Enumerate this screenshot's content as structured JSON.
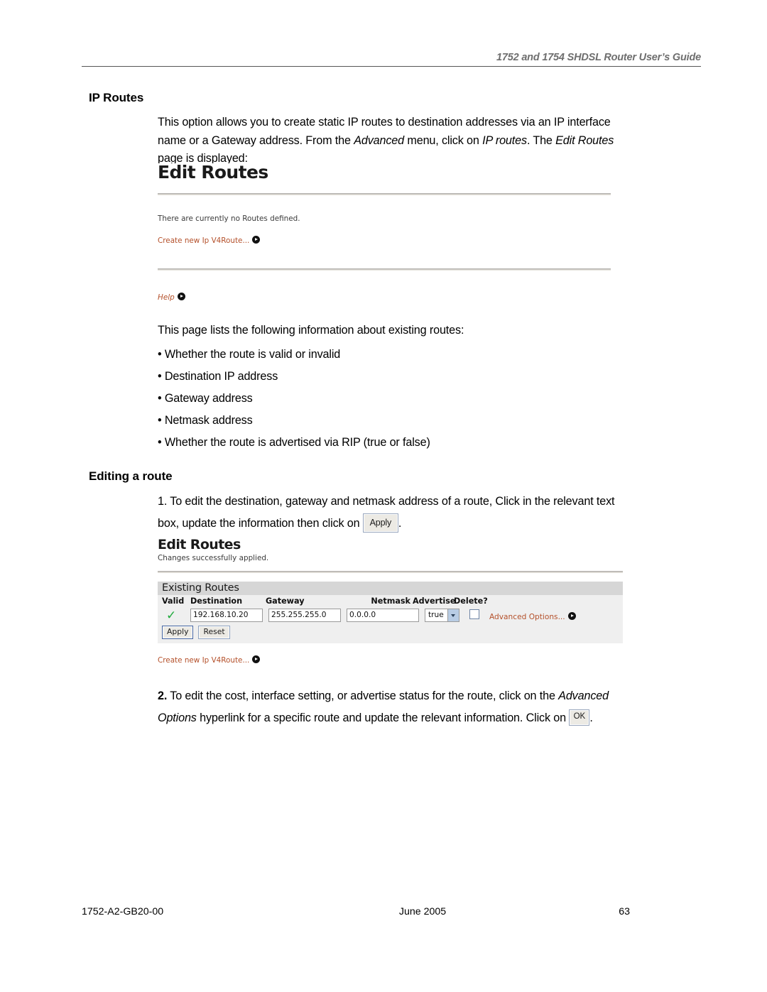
{
  "header": {
    "running_title": "1752 and 1754 SHDSL Router User’s Guide"
  },
  "sections": {
    "ip_routes_heading": "IP Routes",
    "intro_line1": "This option allows you to create static IP routes to destination addresses via an IP interface",
    "intro_line2_a": "name or a Gateway address. From the ",
    "intro_line2_italic1": "Advanced",
    "intro_line2_b": " menu, click on ",
    "intro_line2_italic2": "IP routes",
    "intro_line2_c": ". The ",
    "intro_line2_italic3": "Edit Routes",
    "intro_line3": "page is displayed:",
    "list_intro": "This page lists the following information about existing routes:",
    "bullets": [
      "• Whether the route is valid or invalid",
      "• Destination IP address",
      "• Gateway address",
      "• Netmask address",
      "• Whether the route is advertised via RIP (true or false)"
    ],
    "editing_heading": "Editing a route",
    "step1_line1": "1. To edit the destination, gateway and netmask address of a route, Click in the relevant text",
    "step1_line2_a": "box, update the information then click on",
    "step1_button": "Apply",
    "step1_line2_b": ".",
    "step2_num": "2.",
    "step2_line1_a": " To edit the cost, interface setting, or advertise status for the route, click on the ",
    "step2_line1_italic": "Advanced",
    "step2_line2_italic": "Options",
    "step2_line2_a": " hyperlink for a specific route and update the relevant information. Click on ",
    "step2_button": "OK",
    "step2_line2_b": "."
  },
  "figure1": {
    "title": "Edit Routes",
    "status_text": "There are currently no Routes defined.",
    "create_link": "Create new Ip V4Route...",
    "help_link": "Help",
    "arrow_icon": "arrow-right-circle-icon"
  },
  "figure2": {
    "title": "Edit Routes",
    "status_text": "Changes successfully applied.",
    "panel_title": "Existing Routes",
    "columns": [
      "Valid",
      "Destination",
      "Gateway",
      "Netmask",
      "Advertise",
      "Delete?"
    ],
    "row": {
      "valid_icon": "green-check-icon",
      "destination": "192.168.10.20",
      "gateway": "255.255.255.0",
      "netmask": "0.0.0.0",
      "advertise": "true",
      "delete_checked": false,
      "advanced_link": "Advanced Options..."
    },
    "apply_label": "Apply",
    "reset_label": "Reset",
    "create_link": "Create new Ip V4Route...",
    "accent_link_color": "#b4502a",
    "check_color": "#1faa3c"
  },
  "footer": {
    "doc_number": "1752-A2-GB20-00",
    "date": "June 2005",
    "page_number": "63"
  }
}
